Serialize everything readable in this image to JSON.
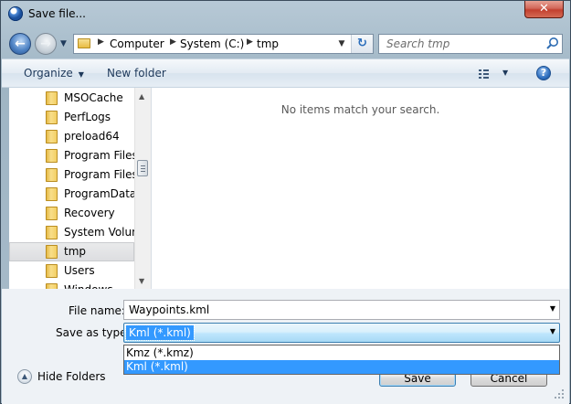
{
  "window": {
    "title": "Save file...",
    "close_glyph": "✕"
  },
  "nav": {
    "back_icon": "back-arrow-icon",
    "forward_icon": "forward-arrow-icon",
    "breadcrumbs": [
      "Computer",
      "System (C:)",
      "tmp"
    ],
    "search_placeholder": "Search tmp"
  },
  "toolbar": {
    "organize_label": "Organize",
    "new_folder_label": "New folder",
    "help_glyph": "?"
  },
  "tree": {
    "items": [
      {
        "label": "MSOCache",
        "selected": false
      },
      {
        "label": "PerfLogs",
        "selected": false
      },
      {
        "label": "preload64",
        "selected": false
      },
      {
        "label": "Program Files",
        "selected": false
      },
      {
        "label": "Program Files (",
        "selected": false
      },
      {
        "label": "ProgramData",
        "selected": false
      },
      {
        "label": "Recovery",
        "selected": false
      },
      {
        "label": "System Volum",
        "selected": false
      },
      {
        "label": "tmp",
        "selected": true
      },
      {
        "label": "Users",
        "selected": false
      },
      {
        "label": "Windows",
        "selected": false
      }
    ]
  },
  "files": {
    "empty_message": "No items match your search."
  },
  "form": {
    "filename_label": "File name:",
    "filename_value": "Waypoints.kml",
    "savetype_label": "Save as type:",
    "savetype_value": "Kml (*.kml)",
    "savetype_options": [
      {
        "label": "Kmz (*.kmz)",
        "selected": false
      },
      {
        "label": "Kml (*.kml)",
        "selected": true
      }
    ]
  },
  "footer": {
    "hide_folders_label": "Hide Folders",
    "save_label": "Save",
    "cancel_label": "Cancel"
  },
  "colors": {
    "selection": "#3399ff",
    "title_bar": "#9fb5c4",
    "close_button": "#c2402f"
  }
}
